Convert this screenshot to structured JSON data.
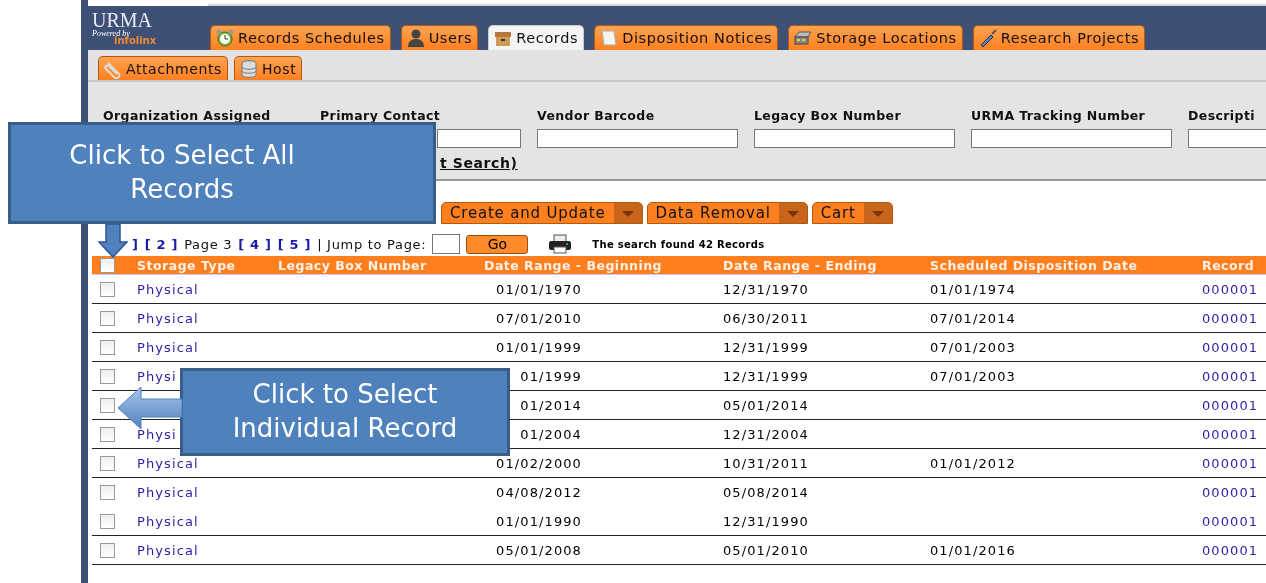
{
  "logo": {
    "name": "URMA",
    "tagline": "Powered by",
    "brand": "infolinx"
  },
  "tabs": [
    {
      "label": "Records Schedules",
      "selected": false
    },
    {
      "label": "Users",
      "selected": false
    },
    {
      "label": "Records",
      "selected": true
    },
    {
      "label": "Disposition Notices",
      "selected": false
    },
    {
      "label": "Storage Locations",
      "selected": false
    },
    {
      "label": "Research Projects",
      "selected": false
    }
  ],
  "subtabs": [
    {
      "label": "Attachments",
      "selected": false
    },
    {
      "label": "Host",
      "selected": false
    }
  ],
  "search_fields": [
    {
      "label": "Organization Assigned",
      "kind": "hidden"
    },
    {
      "label": "Primary Contact",
      "kind": "partial"
    },
    {
      "label": "Vendor Barcode",
      "kind": "full"
    },
    {
      "label": "Legacy Box Number",
      "kind": "full"
    },
    {
      "label": "URMA Tracking Number",
      "kind": "full"
    },
    {
      "label": "Descripti",
      "kind": "full"
    }
  ],
  "search_link": "t Search)",
  "actions": [
    "Create and Update",
    "Data Removal",
    "Cart"
  ],
  "pager": {
    "pages": [
      {
        "label": "]",
        "kind": "link"
      },
      {
        "label": "[ 2 ]",
        "kind": "link"
      },
      {
        "label": "Page 3",
        "kind": "current"
      },
      {
        "label": "[ 4 ]",
        "kind": "link"
      },
      {
        "label": "[ 5 ]",
        "kind": "link"
      }
    ],
    "jump_label": "| Jump to Page:",
    "go": "Go",
    "result": "The search found 42 Records"
  },
  "table": {
    "select_all_checked": false,
    "columns": [
      "Storage Type",
      "Legacy Box Number",
      "Date Range - Beginning",
      "Date Range - Ending",
      "Scheduled Disposition Date",
      "Record"
    ],
    "rows": [
      {
        "checked": false,
        "ruled": true,
        "storage_type": "Physical",
        "begin": "01/01/1970",
        "end": "12/31/1970",
        "disposition": "01/01/1974",
        "record": "000001"
      },
      {
        "checked": false,
        "ruled": true,
        "storage_type": "Physical",
        "begin": "07/01/2010",
        "end": "06/30/2011",
        "disposition": "07/01/2014",
        "record": "000001"
      },
      {
        "checked": false,
        "ruled": true,
        "storage_type": "Physical",
        "begin": "01/01/1999",
        "end": "12/31/1999",
        "disposition": "07/01/2003",
        "record": "000001"
      },
      {
        "checked": false,
        "ruled": true,
        "storage_type": "Physi",
        "begin": "01/1999",
        "end": "12/31/1999",
        "disposition": "07/01/2003",
        "record": "000001"
      },
      {
        "checked": false,
        "ruled": true,
        "begin": "01/2014",
        "end": "05/01/2014",
        "record": "000001"
      },
      {
        "checked": false,
        "ruled": true,
        "storage_type": "Physi",
        "begin": "01/2004",
        "end": "12/31/2004",
        "record": "000001"
      },
      {
        "checked": false,
        "ruled": true,
        "storage_type": "Physical",
        "begin": "01/02/2000",
        "end": "10/31/2011",
        "disposition": "01/01/2012",
        "record": "000001"
      },
      {
        "checked": false,
        "ruled": false,
        "storage_type": "Physical",
        "begin": "04/08/2012",
        "end": "05/08/2014",
        "record": "000001"
      },
      {
        "checked": false,
        "ruled": true,
        "storage_type": "Physical",
        "begin": "01/01/1990",
        "end": "12/31/1990",
        "record": "000001"
      },
      {
        "checked": false,
        "ruled": true,
        "storage_type": "Physical",
        "begin": "05/01/2008",
        "end": "05/01/2010",
        "disposition": "01/01/2016",
        "record": "000001"
      }
    ]
  },
  "callouts": [
    {
      "kind": "down",
      "text": "Click to Select All Records"
    },
    {
      "kind": "left",
      "text": "Click to Select Individual Record"
    }
  ]
}
